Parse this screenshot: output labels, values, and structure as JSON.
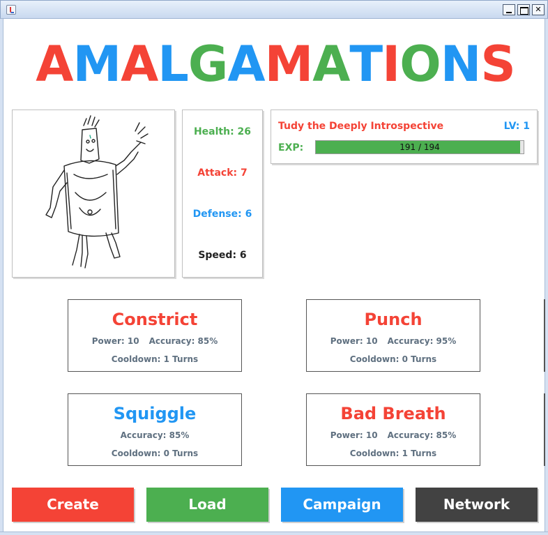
{
  "window": {
    "icon": "java-cup-icon",
    "controls": [
      "minimize",
      "maximize",
      "close"
    ]
  },
  "logo": {
    "letters": [
      {
        "char": "A",
        "color": "#f44336"
      },
      {
        "char": "M",
        "color": "#2196f3"
      },
      {
        "char": "A",
        "color": "#f44336"
      },
      {
        "char": "L",
        "color": "#2196f3"
      },
      {
        "char": "G",
        "color": "#4caf50"
      },
      {
        "char": "A",
        "color": "#2196f3"
      },
      {
        "char": "M",
        "color": "#f44336"
      },
      {
        "char": "A",
        "color": "#4caf50"
      },
      {
        "char": "T",
        "color": "#2196f3"
      },
      {
        "char": "I",
        "color": "#f44336"
      },
      {
        "char": "O",
        "color": "#4caf50"
      },
      {
        "char": "N",
        "color": "#2196f3"
      },
      {
        "char": "S",
        "color": "#f44336"
      }
    ]
  },
  "stats": {
    "health": "Health: 26",
    "attack": "Attack: 7",
    "defense": "Defense: 6",
    "speed": "Speed: 6"
  },
  "creature": {
    "name": "Tudy the Deeply Introspective",
    "level": "LV: 1",
    "exp_label": "EXP:",
    "exp_text": "191 / 194",
    "exp_fraction": 0.9845
  },
  "moves": [
    {
      "name": "Constrict",
      "name_color": "#f44336",
      "power": "Power: 10",
      "accuracy": "Accuracy: 85%",
      "cooldown": "Cooldown: 1 Turns"
    },
    {
      "name": "Punch",
      "name_color": "#f44336",
      "power": "Power: 10",
      "accuracy": "Accuracy: 95%",
      "cooldown": "Cooldown: 0 Turns"
    },
    {
      "name": "Squiggle",
      "name_color": "#2196f3",
      "power": "",
      "accuracy": "Accuracy: 85%",
      "cooldown": "Cooldown: 0 Turns"
    },
    {
      "name": "Bad Breath",
      "name_color": "#f44336",
      "power": "Power: 10",
      "accuracy": "Accuracy: 85%",
      "cooldown": "Cooldown: 1 Turns"
    }
  ],
  "buttons": {
    "create": {
      "label": "Create",
      "color": "#f44336"
    },
    "load": {
      "label": "Load",
      "color": "#4caf50"
    },
    "campaign": {
      "label": "Campaign",
      "color": "#2196f3"
    },
    "network": {
      "label": "Network",
      "color": "#424242"
    }
  }
}
